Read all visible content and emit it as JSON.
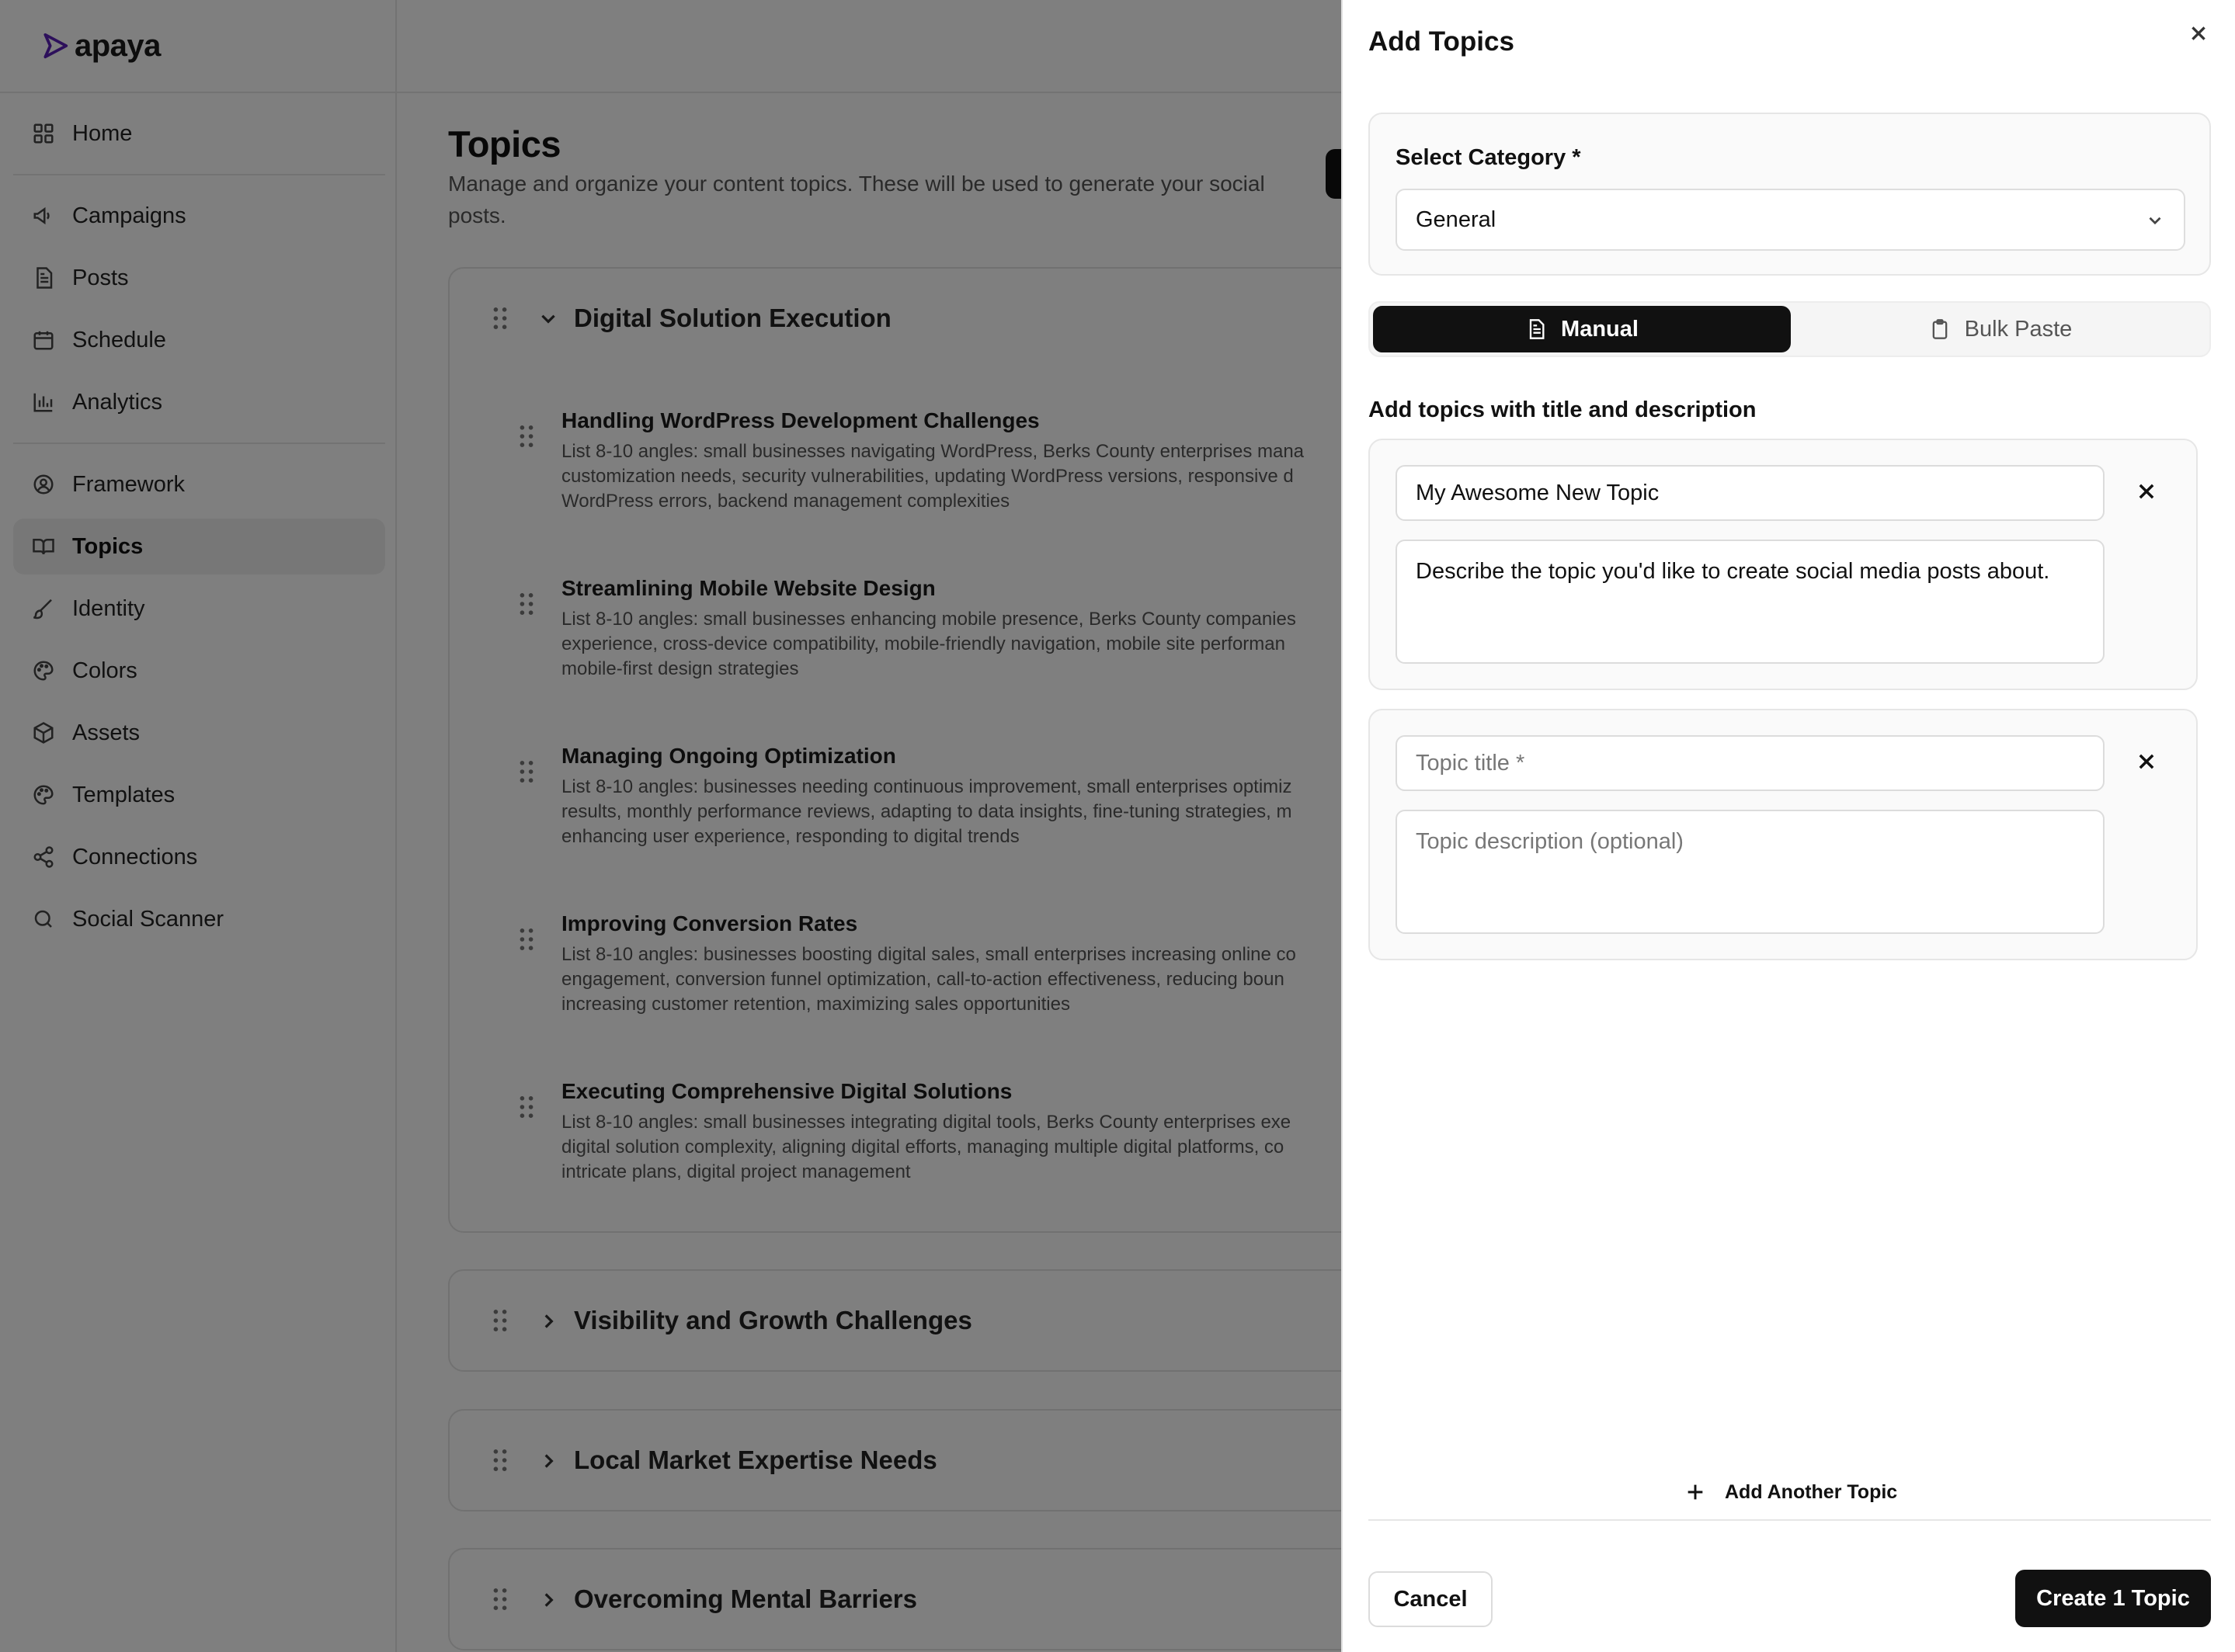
{
  "app": {
    "name": "apaya",
    "brand_color": "#5b21b6"
  },
  "sidebar": {
    "items": [
      {
        "label": "Home",
        "icon": "grid-icon"
      },
      {
        "label": "Campaigns",
        "icon": "megaphone-icon"
      },
      {
        "label": "Posts",
        "icon": "document-icon"
      },
      {
        "label": "Schedule",
        "icon": "calendar-icon"
      },
      {
        "label": "Analytics",
        "icon": "bar-chart-icon"
      },
      {
        "label": "Framework",
        "icon": "user-circle-icon"
      },
      {
        "label": "Topics",
        "icon": "book-open-icon",
        "active": true
      },
      {
        "label": "Identity",
        "icon": "brush-icon"
      },
      {
        "label": "Colors",
        "icon": "palette-icon"
      },
      {
        "label": "Assets",
        "icon": "box-icon"
      },
      {
        "label": "Templates",
        "icon": "palette-icon"
      },
      {
        "label": "Connections",
        "icon": "share-icon"
      },
      {
        "label": "Social Scanner",
        "icon": "search-icon"
      }
    ]
  },
  "main": {
    "title": "Topics",
    "subtitle": "Manage and organize your content topics. These will be used to generate your social posts.",
    "categories": [
      {
        "title": "Digital Solution Execution",
        "expanded": true,
        "topics": [
          {
            "title": "Handling WordPress Development Challenges",
            "description_lines": [
              "List 8-10 angles: small businesses navigating WordPress, Berks County enterprises mana",
              "customization needs, security vulnerabilities, updating WordPress versions, responsive d",
              "WordPress errors, backend management complexities"
            ]
          },
          {
            "title": "Streamlining Mobile Website Design",
            "description_lines": [
              "List 8-10 angles: small businesses enhancing mobile presence, Berks County companies",
              "experience, cross-device compatibility, mobile-friendly navigation, mobile site performan",
              "mobile-first design strategies"
            ]
          },
          {
            "title": "Managing Ongoing Optimization",
            "description_lines": [
              "List 8-10 angles: businesses needing continuous improvement, small enterprises optimiz",
              "results, monthly performance reviews, adapting to data insights, fine-tuning strategies, m",
              "enhancing user experience, responding to digital trends"
            ]
          },
          {
            "title": "Improving Conversion Rates",
            "description_lines": [
              "List 8-10 angles: businesses boosting digital sales, small enterprises increasing online co",
              "engagement, conversion funnel optimization, call-to-action effectiveness, reducing boun",
              "increasing customer retention, maximizing sales opportunities"
            ]
          },
          {
            "title": "Executing Comprehensive Digital Solutions",
            "description_lines": [
              "List 8-10 angles: small businesses integrating digital tools, Berks County enterprises exe",
              "digital solution complexity, aligning digital efforts, managing multiple digital platforms, co",
              "intricate plans, digital project management"
            ]
          }
        ]
      },
      {
        "title": "Visibility and Growth Challenges",
        "expanded": false
      },
      {
        "title": "Local Market Expertise Needs",
        "expanded": false
      },
      {
        "title": "Overcoming Mental Barriers",
        "expanded": false
      }
    ]
  },
  "drawer": {
    "title": "Add Topics",
    "category": {
      "label": "Select Category *",
      "selected": "General"
    },
    "tabs": {
      "manual": "Manual",
      "bulk": "Bulk Paste",
      "active": "manual"
    },
    "section_label": "Add topics with title and description",
    "forms": [
      {
        "title_value": "My Awesome New Topic",
        "title_placeholder": "Topic title *",
        "description_value": "Describe the topic you'd like to create social media posts about.",
        "description_placeholder": "Topic description (optional)"
      },
      {
        "title_value": "",
        "title_placeholder": "Topic title *",
        "description_value": "",
        "description_placeholder": "Topic description (optional)"
      }
    ],
    "add_another_label": "Add Another Topic",
    "cancel_label": "Cancel",
    "create_label": "Create 1 Topic"
  }
}
